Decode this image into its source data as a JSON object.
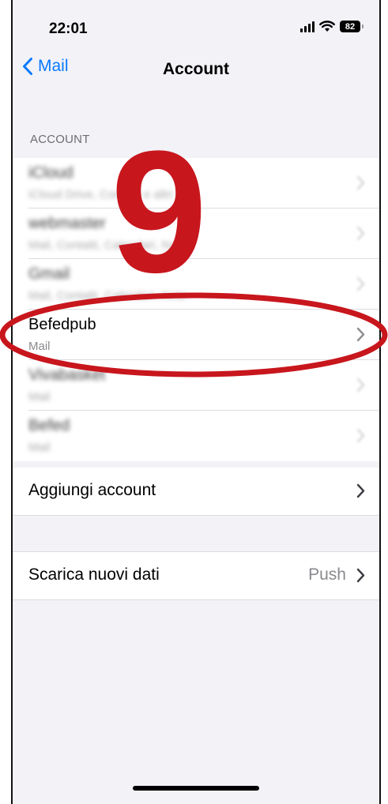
{
  "status_bar": {
    "time": "22:01",
    "battery": "82"
  },
  "nav": {
    "back_label": "Mail",
    "title": "Account"
  },
  "accounts_section": {
    "header": "ACCOUNT",
    "items": [
      {
        "title": "iCloud",
        "subtitle": "iCloud Drive, Contatti e altri 11...",
        "blurred": true
      },
      {
        "title": "webmaster",
        "subtitle": "Mail, Contatti, Calendari, Note",
        "blurred": true
      },
      {
        "title": "Gmail",
        "subtitle": "Mail, Contatti, Calendari, Note",
        "blurred": true
      },
      {
        "title": "Befedpub",
        "subtitle": "Mail",
        "blurred": false
      },
      {
        "title": "Vivabasket",
        "subtitle": "Mail",
        "blurred": true
      },
      {
        "title": "Befed",
        "subtitle": "Mail",
        "blurred": true
      }
    ],
    "add_account_label": "Aggiungi account"
  },
  "fetch_section": {
    "label": "Scarica nuovi dati",
    "value": "Push"
  },
  "annotation": {
    "step_number": "9",
    "color": "#c8161d"
  },
  "colors": {
    "accent": "#0a7aff",
    "background": "#f2f2f7"
  }
}
